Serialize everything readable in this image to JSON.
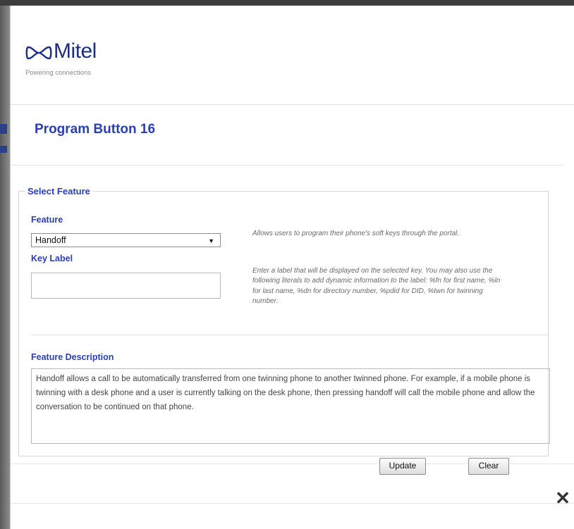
{
  "brand": {
    "name": "Mitel",
    "tagline": "Powering connections",
    "color": "#1d2f83"
  },
  "dialog": {
    "title": "Program Button 16"
  },
  "select_feature": {
    "legend": "Select Feature",
    "feature_label": "Feature",
    "feature_value": "Handoff",
    "feature_help": "Allows users to program their phone's soft keys through the portal.",
    "key_label_label": "Key Label",
    "key_label_value": "",
    "key_label_help": "Enter a label that will be displayed on the selected key. You may also use the following literals to add dynamic information to the label: %fn for first name, %ln for last name, %dn for directory number, %pdid for DID, %twn for twinning number.",
    "description_label": "Feature Description",
    "description_text": "Handoff allows a call to be automatically transferred from one twinning phone to another twinned phone. For example, if a mobile phone is twinning with a desk phone and a user is currently talking on the desk phone, then pressing handoff will call the mobile phone and allow the conversation to be continued on that phone."
  },
  "actions": {
    "update": "Update",
    "clear": "Clear",
    "close_icon": "close-icon",
    "close_glyph": "✕"
  },
  "colors": {
    "heading": "#2a3fb6",
    "backdrop": "#6f6f6f"
  }
}
